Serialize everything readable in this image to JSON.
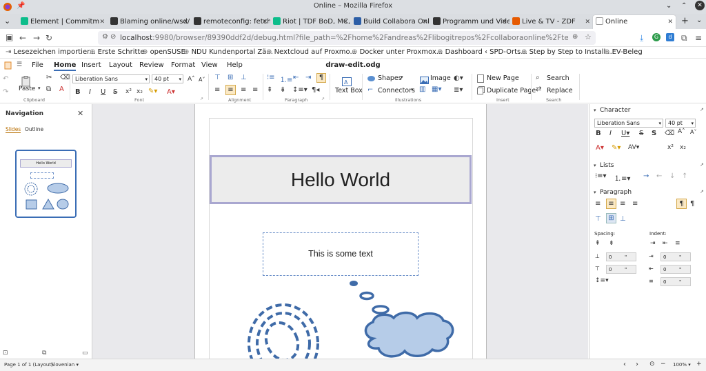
{
  "window": {
    "title": "Online – Mozilla Firefox"
  },
  "tabs": [
    {
      "label": "Element | Commitm",
      "color": "#0dbd8b"
    },
    {
      "label": "Blaming online/wsd/",
      "color": "#333333"
    },
    {
      "label": "remoteconfig: fetch",
      "color": "#333333"
    },
    {
      "label": "Riot | TDF BoD, MC,",
      "color": "#0dbd8b"
    },
    {
      "label": "Build Collabora Onli",
      "color": "#2c5ea6"
    },
    {
      "label": "Programm und Vide",
      "color": "#333333"
    },
    {
      "label": "Live & TV - ZDF",
      "color": "#e65a00"
    },
    {
      "label": "Online",
      "color": "#ffffff"
    }
  ],
  "url": {
    "host": "localhost",
    "rest": ":9980/browser/89390ddf2d/debug.html?file_path=%2Fhome%2Fandreas%2Flibogitrepos%2Fcollaboraonline%2Ftest%2Fsamples%2Fd"
  },
  "bookmarks": [
    "Lesezeichen importier...",
    "Erste Schritte",
    "openSUSE",
    "NDU Kundenportal Zä...",
    "Nextcloud auf Proxmo...",
    "Docker unter Proxmox...",
    "Dashboard ‹ SPD-Orts...",
    "Step by Step to Install ...",
    "EV-Beleg"
  ],
  "menu": {
    "items": [
      "File",
      "Home",
      "Insert",
      "Layout",
      "Review",
      "Format",
      "View",
      "Help"
    ],
    "doc_title": "draw-edit.odg"
  },
  "ribbon": {
    "paste": "Paste",
    "clipboard": "Clipboard",
    "font_name": "Liberation Sans",
    "font_size": "40 pt",
    "font_group": "Font",
    "alignment_group": "Alignment",
    "paragraph_group": "Paragraph",
    "textbox": "Text Box",
    "shapes": "Shapes",
    "connectors": "Connectors",
    "image": "Image",
    "illustrations": "Illustrations",
    "new_page": "New Page",
    "duplicate_page": "Duplicate Page",
    "insert_group": "Insert",
    "search": "Search",
    "replace": "Replace",
    "search_group": "Search"
  },
  "navigation": {
    "title": "Navigation",
    "tab_slides": "Slides",
    "tab_outline": "Outline",
    "thumb_title": "Hello World"
  },
  "slide": {
    "title": "Hello World",
    "text": "This is some text"
  },
  "sidebar": {
    "character": "Character",
    "font_name": "Liberation Sans",
    "font_size": "40 pt",
    "lists": "Lists",
    "paragraph": "Paragraph",
    "spacing": "Spacing:",
    "indent": "Indent:",
    "zero": "0",
    "unit": "\""
  },
  "status": {
    "page": "Page 1 of 1 (Layout)",
    "language": "Slovenian",
    "zoom": "100%"
  }
}
